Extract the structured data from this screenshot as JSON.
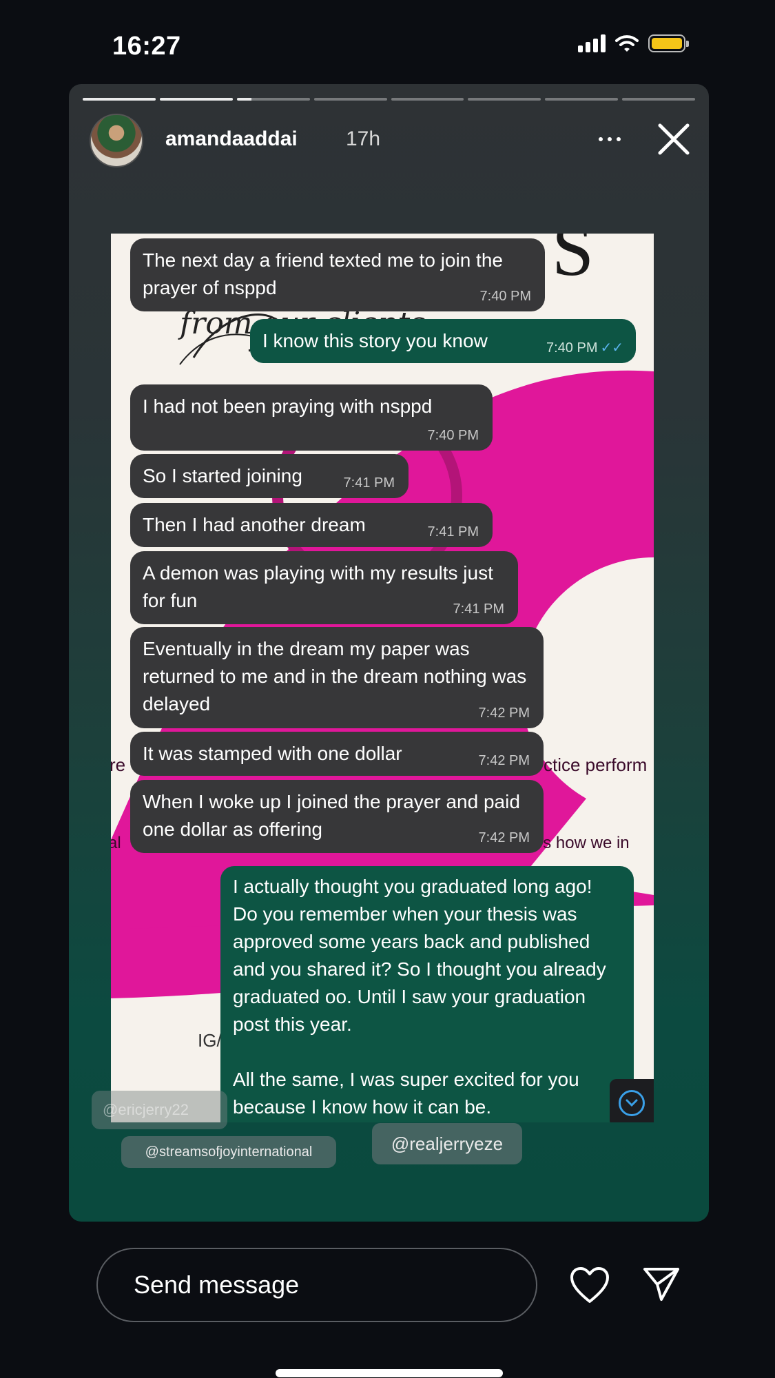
{
  "status_bar": {
    "time": "16:27"
  },
  "story": {
    "username": "amandaaddai",
    "time_ago": "17h",
    "progress": {
      "segments": 8,
      "completed": 2,
      "current_fraction": 0.2
    }
  },
  "background_text": {
    "heading_fragment": "S",
    "script_line": "from our clients",
    "line1": "ctice perform",
    "line1_left": "re",
    "line2": "t's how we in",
    "line2_left": "al",
    "ig": "IG/"
  },
  "messages": [
    {
      "dir": "in",
      "text": "The next day a friend texted me to join the prayer of nsppd",
      "time": "7:40 PM"
    },
    {
      "dir": "out",
      "text": "I know this story you know",
      "time": "7:40 PM",
      "read_ticks": "✓✓"
    },
    {
      "dir": "in",
      "text": "I had not been praying with nsppd",
      "time": "7:40 PM"
    },
    {
      "dir": "in",
      "text": "So I started joining",
      "time": "7:41 PM"
    },
    {
      "dir": "in",
      "text": "Then I had another dream",
      "time": "7:41 PM"
    },
    {
      "dir": "in",
      "text": "A demon was playing with my results just for fun",
      "time": "7:41 PM"
    },
    {
      "dir": "in",
      "text": "Eventually in the dream my paper was returned to me and in the dream nothing was delayed",
      "time": "7:42 PM"
    },
    {
      "dir": "in",
      "text": "It was stamped with one dollar",
      "time": "7:42 PM"
    },
    {
      "dir": "in",
      "text": "When I woke up I joined the prayer and paid one dollar as offering",
      "time": "7:42 PM"
    },
    {
      "dir": "out",
      "text": "I actually thought you graduated long ago! Do you remember when your thesis was approved some years back and published and you shared it? So I thought you already graduated oo. Until I saw your graduation post this year.",
      "text2": "All the same, I was super excited for you because I know how it can be."
    }
  ],
  "mention_tags": [
    "@ericjerry22",
    "@streamsofjoyinternational",
    "@realjerryeze"
  ],
  "reply_bar": {
    "placeholder": "Send message"
  },
  "colors": {
    "incoming_bubble": "#373739",
    "outgoing_bubble": "#0d5544",
    "magenta": "#e0179a",
    "read_tick": "#5bb4f0"
  },
  "icons": [
    "more-icon",
    "close-icon",
    "chevron-down-icon",
    "heart-icon",
    "send-icon"
  ]
}
